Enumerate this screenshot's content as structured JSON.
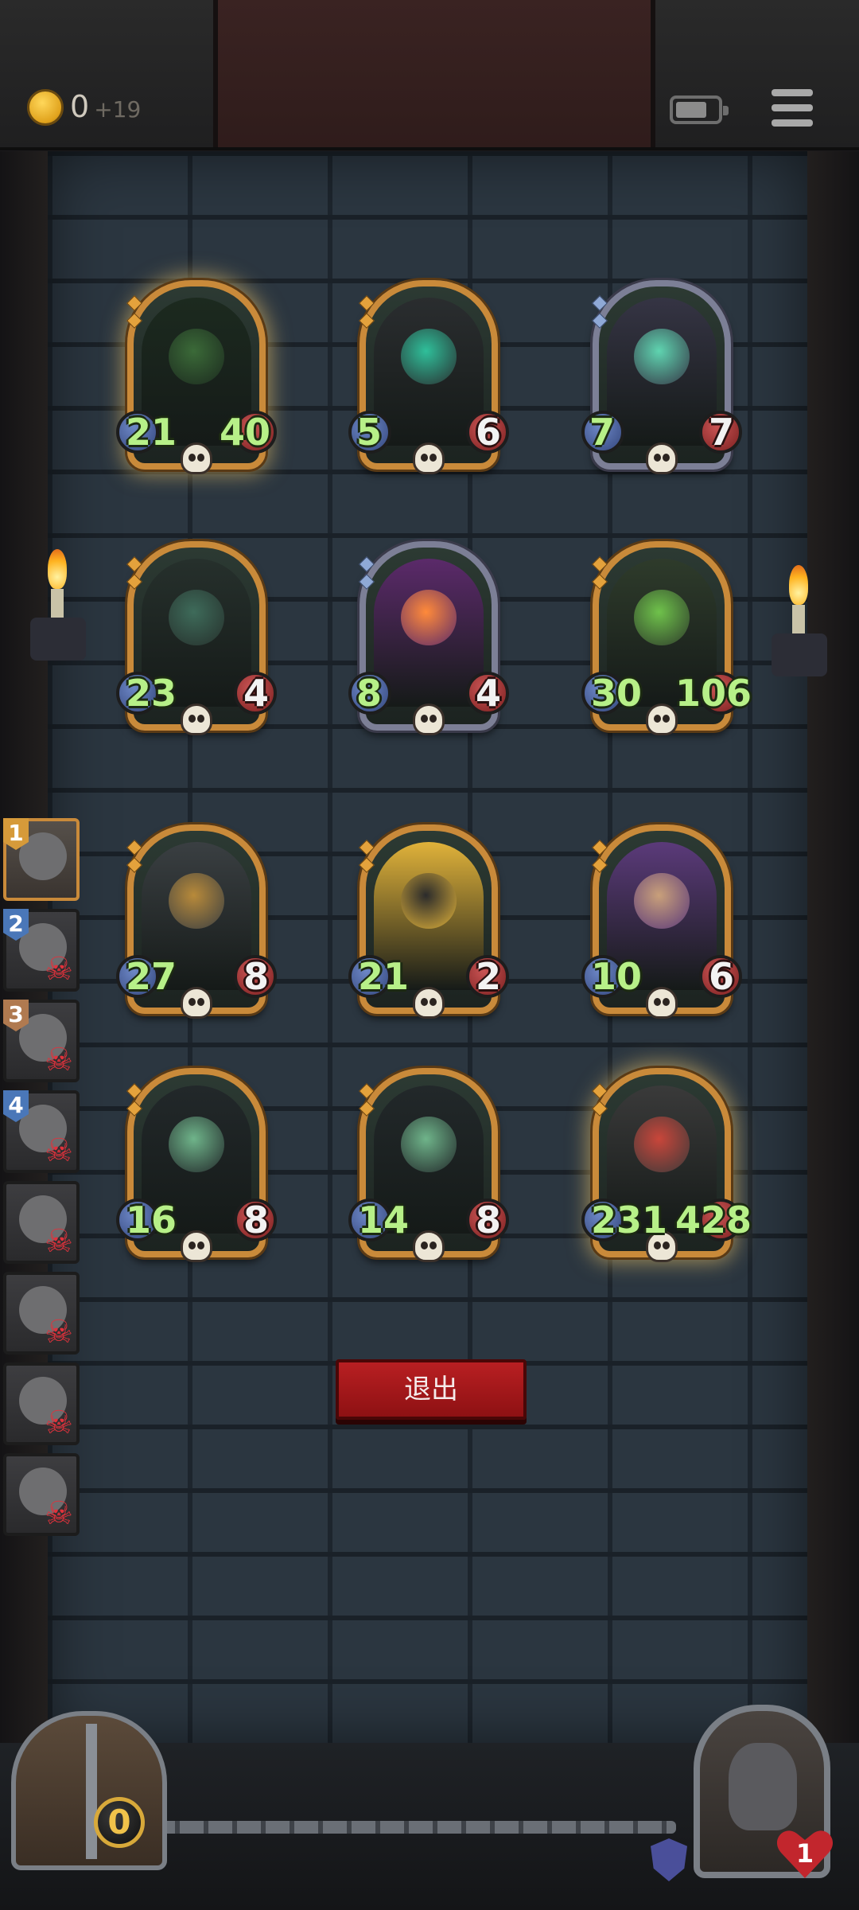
{
  "header": {
    "gold": "0",
    "gold_income": "+19"
  },
  "board": {
    "cards": [
      {
        "attack": "21",
        "health": "40",
        "frame": "gold",
        "glow": true,
        "art": "horned-skeleton-reaper"
      },
      {
        "attack": "5",
        "health": "6",
        "frame": "gold",
        "glow": false,
        "art": "demon-green-vortex"
      },
      {
        "attack": "7",
        "health": "7",
        "frame": "silver",
        "glow": false,
        "art": "ghost-flame-skeleton"
      },
      {
        "attack": "23",
        "health": "4",
        "frame": "gold",
        "glow": false,
        "art": "mimic-chest-monster"
      },
      {
        "attack": "8",
        "health": "4",
        "frame": "silver",
        "glow": false,
        "art": "fire-boar"
      },
      {
        "attack": "30",
        "health": "106",
        "frame": "gold",
        "glow": false,
        "art": "leaf-haired-girl"
      },
      {
        "attack": "27",
        "health": "8",
        "frame": "gold",
        "glow": false,
        "art": "steampunk-contraption"
      },
      {
        "attack": "21",
        "health": "2",
        "frame": "gold",
        "glow": false,
        "art": "masked-bomber"
      },
      {
        "attack": "10",
        "health": "6",
        "frame": "gold",
        "glow": false,
        "art": "airship-bomb"
      },
      {
        "attack": "16",
        "health": "8",
        "frame": "gold",
        "glow": false,
        "art": "hooded-skeleton-green"
      },
      {
        "attack": "14",
        "health": "8",
        "frame": "gold",
        "glow": false,
        "art": "hooded-skeleton-green"
      },
      {
        "attack": "231",
        "health": "428",
        "frame": "gold",
        "glow": true,
        "art": "red-robot-brute"
      }
    ]
  },
  "roster": {
    "slots": [
      {
        "rank": "1",
        "badge": "gold",
        "active": true,
        "dead": false
      },
      {
        "rank": "2",
        "badge": "blue",
        "active": false,
        "dead": true
      },
      {
        "rank": "3",
        "badge": "bronze",
        "active": false,
        "dead": true
      },
      {
        "rank": "4",
        "badge": "blue",
        "active": false,
        "dead": true
      },
      {
        "rank": "",
        "badge": "",
        "active": false,
        "dead": true
      },
      {
        "rank": "",
        "badge": "",
        "active": false,
        "dead": true
      },
      {
        "rank": "",
        "badge": "",
        "active": false,
        "dead": true
      },
      {
        "rank": "",
        "badge": "",
        "active": false,
        "dead": true
      }
    ],
    "dead_symbol": "☠"
  },
  "actions": {
    "exit_label": "退出"
  },
  "footer": {
    "chest_count": "0",
    "lives": "1"
  },
  "colors": {
    "attack_text": "#b7f088",
    "exit_button": "#a8181b",
    "gold_frame": "#c98a3a",
    "silver_frame": "#7c7f96"
  }
}
